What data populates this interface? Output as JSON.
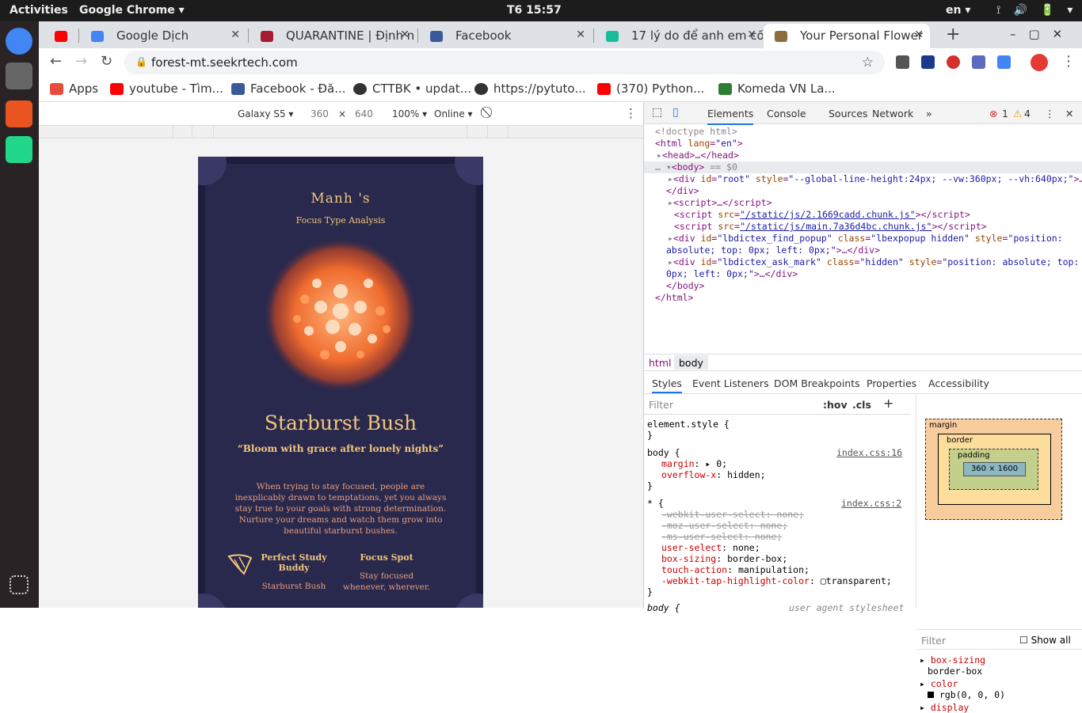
{
  "topbar": {
    "activities": "Activities",
    "app": "Google Chrome ▾",
    "clock": "T6 15:57",
    "lang": "en ▾",
    "tray": "⟟ 🔊 🔋 ▾"
  },
  "tabs": [
    {
      "title": "",
      "color": "#ff0000"
    },
    {
      "title": "Google Dịch",
      "color": "#4285f4"
    },
    {
      "title": "QUARANTINE | Định n",
      "color": "#a51c30"
    },
    {
      "title": "Facebook",
      "color": "#3b5998"
    },
    {
      "title": "17 lý do để anh em cố",
      "color": "#1abc9c"
    },
    {
      "title": "Your Personal Flower",
      "color": "#8b6d3f"
    }
  ],
  "omnibox": {
    "url": "forest-mt.seekrtech.com"
  },
  "bookmarks": [
    {
      "label": "Apps",
      "color": "#e74c3c"
    },
    {
      "label": "youtube - Tìm...",
      "color": "#ff0000"
    },
    {
      "label": "Facebook - Đă...",
      "color": "#3b5998"
    },
    {
      "label": "CTTBK • updat...",
      "color": "#333333"
    },
    {
      "label": "https://pytuto...",
      "color": "#333333"
    },
    {
      "label": "(370) Python...",
      "color": "#ff0000"
    },
    {
      "label": "Komeda VN La...",
      "color": "#2e7d32"
    }
  ],
  "devbar": {
    "device": "Galaxy S5 ▾",
    "width": "360",
    "x": "×",
    "height": "640",
    "zoom": "100% ▾",
    "network": "Online ▾"
  },
  "page": {
    "name": "Manh 's",
    "subtitle": "Focus Type Analysis",
    "title": "Starburst Bush",
    "quote": "“Bloom with grace after lonely nights”",
    "description": "When trying to stay focused, people are inexplicably drawn to temptations, yet you always stay true to your goals with strong determination. Nurture your dreams and watch them grow into beautiful starburst bushes.",
    "buddy_h": "Perfect Study Buddy",
    "buddy_v": "Starburst Bush",
    "spot_h": "Focus Spot",
    "spot_v": "Stay focused whenever, wherever."
  },
  "devtools": {
    "tabs": [
      "Elements",
      "Console",
      "Sources",
      "Network",
      "»"
    ],
    "errors": "1",
    "warnings": "4",
    "crumbs": [
      "html",
      "body"
    ],
    "subtabs": [
      "Styles",
      "Event Listeners",
      "DOM Breakpoints",
      "Properties",
      "Accessibility"
    ],
    "filter_placeholder": "Filter",
    "hov": ":hov",
    "cls": ".cls",
    "box": {
      "margin": "margin",
      "border": "border",
      "padding": "padding",
      "dash": "–",
      "content": "360 × 1600"
    },
    "computed_filter": "Filter",
    "show_all": "Show all",
    "computed": [
      {
        "name": "box-sizing",
        "value": "border-box"
      },
      {
        "name": "color",
        "value": "rgb(0, 0, 0)"
      },
      {
        "name": "display",
        "value": ""
      }
    ]
  }
}
